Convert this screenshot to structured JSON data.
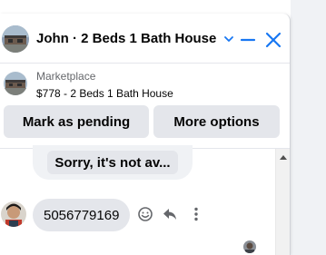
{
  "header": {
    "title": "John · 2 Beds 1 Bath House",
    "icons": {
      "avatar": "contact-avatar",
      "chevron": "chevron-down-icon",
      "minimize": "minimize-icon",
      "close": "close-icon"
    }
  },
  "listing": {
    "source": "Marketplace",
    "title": "$778 - 2 Beds 1 Bath House"
  },
  "actions": {
    "mark_pending": "Mark as pending",
    "more_options": "More options"
  },
  "thread": {
    "previous_message": "Sorry, it's not av...",
    "message": "5056779169",
    "message_actions": [
      "emoji-react-icon",
      "reply-icon",
      "more-vertical-icon"
    ]
  },
  "colors": {
    "accent": "#1877f2",
    "button_bg": "#e4e6eb",
    "text": "#050505",
    "secondary_text": "#65676b"
  }
}
